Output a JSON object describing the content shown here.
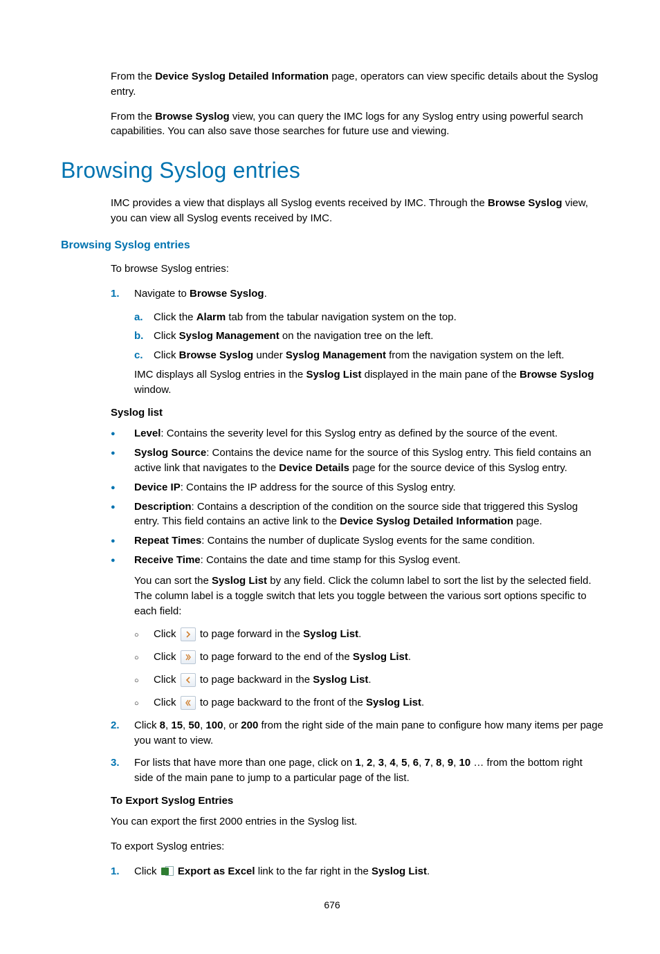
{
  "intro": {
    "p1_pre": "From the ",
    "p1_b1": "Device Syslog Detailed Information",
    "p1_post": " page, operators can view specific details about the Syslog entry.",
    "p2_pre": "From the ",
    "p2_b1": "Browse Syslog",
    "p2_post": " view, you can query the IMC logs for any Syslog entry using powerful search capabilities. You can also save those searches for future use and viewing."
  },
  "h1": "Browsing Syslog entries",
  "intro2_pre": "IMC provides a view that displays all Syslog events received by IMC. Through the ",
  "intro2_b": "Browse Syslog",
  "intro2_post": " view, you can view all Syslog events received by IMC.",
  "h2": "Browsing Syslog entries",
  "pre_list": "To browse Syslog entries:",
  "ol": [
    {
      "num": "1.",
      "pre": "Navigate to ",
      "b": "Browse Syslog",
      "post": "."
    },
    {
      "num": "2.",
      "pre": "Click ",
      "b": "8",
      "mid1": ", ",
      "b2": "15",
      "mid2": ", ",
      "b3": "50",
      "mid3": ", ",
      "b4": "100",
      "mid4": ", or ",
      "b5": "200",
      "post": " from the right side of the main pane to configure how many items per page you want to view."
    },
    {
      "num": "3.",
      "pre": "For lists that have more than one page, click on ",
      "b": "1",
      "mid1": ", ",
      "b2": "2",
      "mid2": ", ",
      "b3": "3",
      "mid3": ", ",
      "b4": "4",
      "mid4": ", ",
      "b5": "5",
      "mid5": ", ",
      "b6": "6",
      "mid6": ", ",
      "b7": "7",
      "mid7": ", ",
      "b8": "8",
      "mid8": ", ",
      "b9": "9",
      "mid9": ", ",
      "b10": "10",
      "post": " … from the bottom right side of the main pane to jump to a particular page of the list."
    }
  ],
  "sub_ol": [
    {
      "num": "a.",
      "pre": "Click the ",
      "b": "Alarm",
      "post": " tab from the tabular navigation system on the top."
    },
    {
      "num": "b.",
      "pre": "Click ",
      "b": "Syslog Management",
      "post": " on the navigation tree on the left."
    },
    {
      "num": "c.",
      "pre": "Click ",
      "b": "Browse Syslog",
      "mid": " under ",
      "b2": "Syslog Management",
      "post": " from the navigation system on the left."
    }
  ],
  "after_sub_p_pre": "IMC displays all Syslog entries in the ",
  "after_sub_p_b1": "Syslog List",
  "after_sub_p_mid": " displayed in the main pane of the ",
  "after_sub_p_b2": "Browse Syslog",
  "after_sub_p_post": " window.",
  "syslog_list_hdr": "Syslog list",
  "bullets": [
    {
      "b": "Level",
      "post": ": Contains the severity level for this Syslog entry as defined by the source of the event."
    },
    {
      "b": "Syslog Source",
      "post": ": Contains the device name for the source of this Syslog entry. This field contains an active link that navigates to the ",
      "b2": "Device Details",
      "post2": " page for the source device of this Syslog entry."
    },
    {
      "b": "Device IP",
      "post": ": Contains the IP address for the source of this Syslog entry."
    },
    {
      "b": "Description",
      "post": ": Contains a description of the condition on the source side that triggered this Syslog entry. This field contains an active link to the ",
      "b2": "Device Syslog Detailed Information",
      "post2": " page."
    },
    {
      "b": "Repeat Times",
      "post": ": Contains the number of duplicate Syslog events for the same condition."
    },
    {
      "b": "Receive Time",
      "post": ": Contains the date and time stamp for this Syslog event."
    }
  ],
  "sortpara_pre": "You can sort the ",
  "sortpara_b": "Syslog List",
  "sortpara_post": " by any field. Click the column label to sort the list by the selected field. The column label is a toggle switch that lets you toggle between the various sort options specific to each field:",
  "pagers": [
    {
      "pre": "Click ",
      "mid": " to page forward in the ",
      "b": "Syslog List",
      "post": "."
    },
    {
      "pre": "Click ",
      "mid": " to page forward to the end of the ",
      "b": "Syslog List",
      "post": "."
    },
    {
      "pre": "Click ",
      "mid": " to page backward in the ",
      "b": "Syslog List",
      "post": "."
    },
    {
      "pre": "Click ",
      "mid": " to page backward to the front of the ",
      "b": "Syslog List",
      "post": "."
    }
  ],
  "export_hdr": "To Export Syslog Entries",
  "export_p1": "You can export the first 2000 entries in the Syslog list.",
  "export_p2": "To export Syslog entries:",
  "export_step": {
    "num": "1.",
    "pre": "Click ",
    "b": "Export as Excel",
    "mid": " link to the far right in the ",
    "b2": "Syslog List",
    "post": "."
  },
  "page_num": "676"
}
